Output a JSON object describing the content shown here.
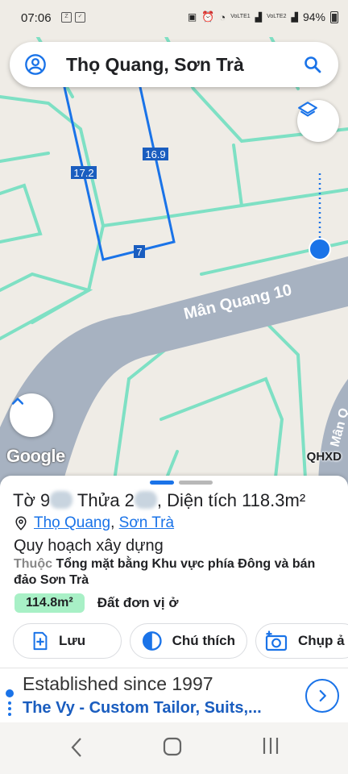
{
  "status_bar": {
    "time": "07:06",
    "notif_icons": [
      "zalo-icon",
      "checkbox-icon"
    ],
    "network1": "VoLTE1",
    "network2": "VoLTE2",
    "battery": "94%"
  },
  "search": {
    "query": "Thọ Quang, Sơn Trà"
  },
  "map": {
    "lot_edges": [
      "17.2",
      "16.9",
      "7"
    ],
    "street_label": "Mân Quang 10",
    "edge_street_label": "Mân Q",
    "google_logo": "Google",
    "layer_label": "QHXD",
    "colors": {
      "background": "#efece6",
      "road": "#a7b2c1",
      "boundary": "#7ee0c4",
      "parcel": "#1a73e8"
    }
  },
  "sheet": {
    "title_prefix": "Tờ 9",
    "title_mid": " Thửa 2",
    "title_area_label": ", Diện tích ",
    "title_area_value": "118.3m²",
    "ward": "Thọ Quang",
    "separator": ", ",
    "district": "Sơn Trà",
    "plan_heading": "Quy hoạch xây dựng",
    "belong_prefix": "Thuộc",
    "belong_text": " Tổng mặt bằng Khu vực phía Đông và bán đảo Sơn Trà",
    "area_badge": "114.8m²",
    "area_type": "Đất đơn vị ở",
    "actions": {
      "save": "Lưu",
      "legend": "Chú thích",
      "capture": "Chụp ả"
    }
  },
  "ad": {
    "line1": "Established since 1997",
    "line2": "The Vy - Custom Tailor, Suits,..."
  }
}
